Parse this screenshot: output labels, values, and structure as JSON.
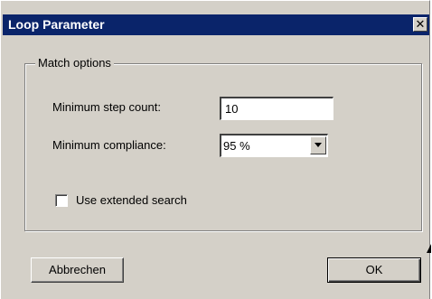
{
  "window": {
    "title": "Loop Parameter",
    "close_symbol": "✕"
  },
  "match_options": {
    "legend": "Match options",
    "min_step_label": "Minimum step count:",
    "min_step_value": "10",
    "min_compliance_label": "Minimum compliance:",
    "min_compliance_value": "95 %",
    "extended_search_label": "Use extended search",
    "extended_search_checked": false
  },
  "buttons": {
    "cancel_label": "Abbrechen",
    "ok_label": "OK"
  },
  "colors": {
    "titlebar": "#0a246a",
    "dialog_face": "#d4d0c8"
  }
}
